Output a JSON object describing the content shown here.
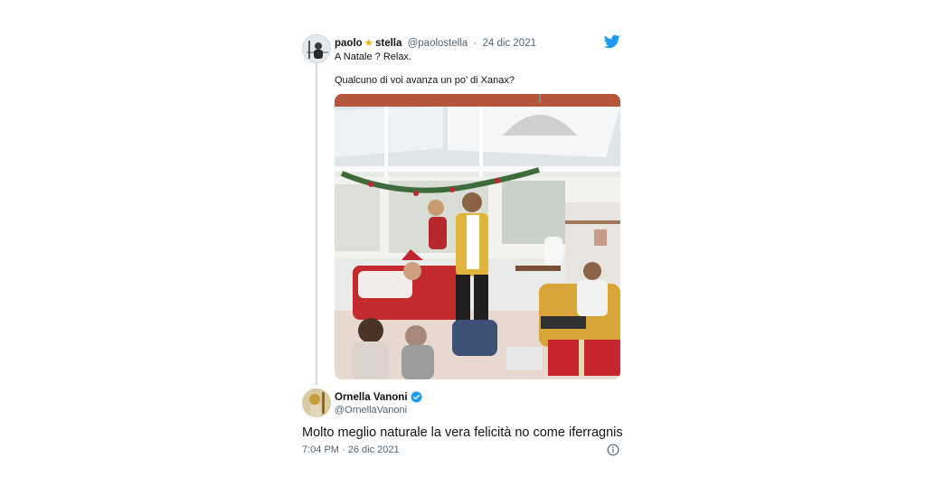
{
  "tweet1": {
    "name_first": "paolo",
    "star": "★",
    "name_last": "stella",
    "handle": "@paolostella",
    "separator": "·",
    "date": "24 dic 2021",
    "line1": "A Natale ? Relax.",
    "line2": "Qualcuno di voi avanza un po’ di Xanax?"
  },
  "tweet2": {
    "name": "Ornella Vanoni",
    "handle": "@OrnellaVanoni",
    "text": "Molto meglio naturale la vera felicità no come iferragnis",
    "timestamp": "7:04 PM · 26 dic 2021"
  },
  "icons": {
    "brand": "twitter-bird-icon",
    "verified": "verified-badge-icon",
    "info": "info-icon"
  },
  "colors": {
    "twitter_blue": "#1d9bf0",
    "star": "#f5b50a",
    "muted": "#536471",
    "thread_line": "#cfd9de"
  }
}
